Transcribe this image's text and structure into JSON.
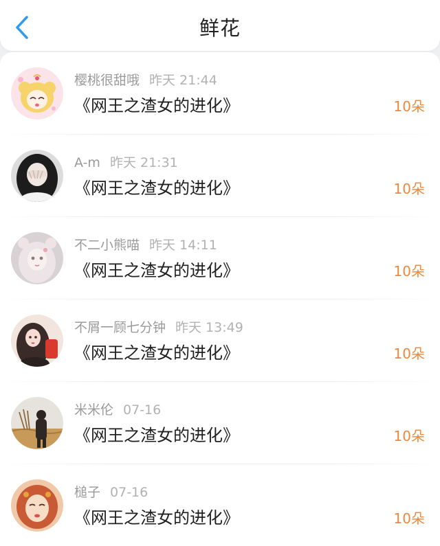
{
  "header": {
    "title": "鲜花",
    "back_icon": "chevron-left-icon",
    "accent_color": "#2f9bf0"
  },
  "count_color": "#f0883c",
  "items": [
    {
      "username": "樱桃很甜哦",
      "time": "昨天 21:44",
      "book": "《网王之渣女的进化》",
      "count": "10朵"
    },
    {
      "username": "A-m",
      "time": "昨天 21:31",
      "book": "《网王之渣女的进化》",
      "count": "10朵"
    },
    {
      "username": "不二小熊喵",
      "time": "昨天 14:11",
      "book": "《网王之渣女的进化》",
      "count": "10朵"
    },
    {
      "username": "不屑一顾七分钟",
      "time": "昨天 13:49",
      "book": "《网王之渣女的进化》",
      "count": "10朵"
    },
    {
      "username": "米米伦",
      "time": "07-16",
      "book": "《网王之渣女的进化》",
      "count": "10朵"
    },
    {
      "username": "槌子",
      "time": "07-16",
      "book": "《网王之渣女的进化》",
      "count": "10朵"
    }
  ]
}
